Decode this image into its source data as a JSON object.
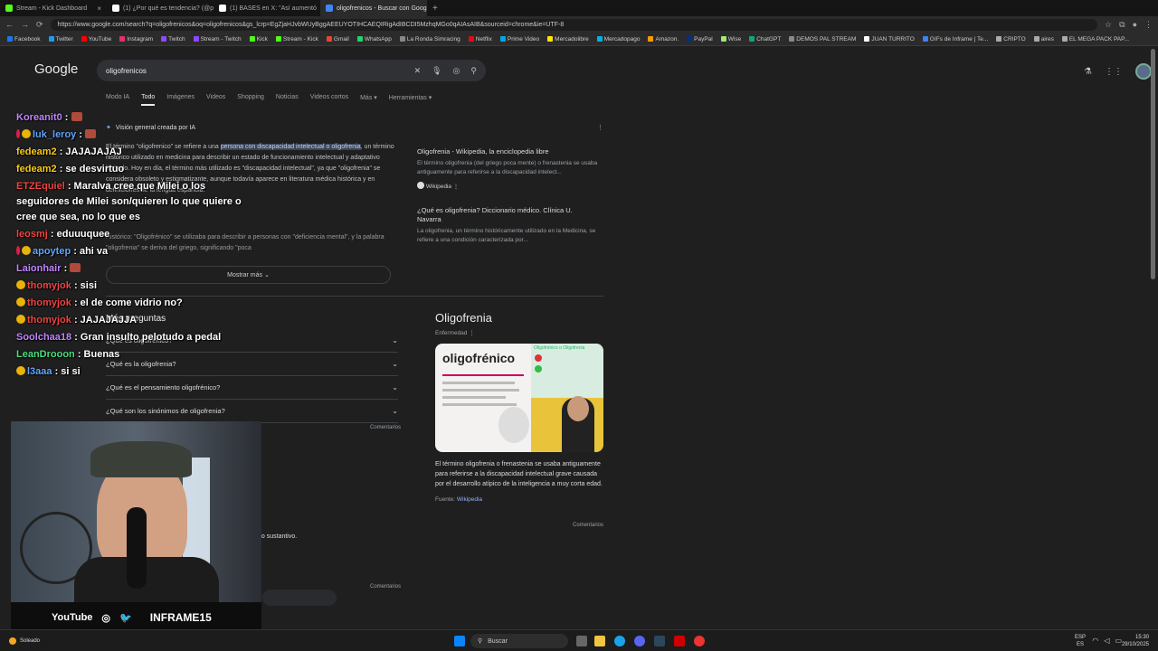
{
  "tabs": [
    {
      "label": "Stream - Kick Dashboard",
      "color": "#53fc18"
    },
    {
      "label": "(1) ¿Por qué es tendencia? (@por",
      "color": "#fff"
    },
    {
      "label": "(1) BASES en X: \"Así aumentó",
      "color": "#fff"
    },
    {
      "label": "oligofrenicos - Buscar con Google",
      "color": "#4285f4",
      "active": true
    }
  ],
  "url": "https://www.google.com/search?q=oligofrenicos&oq=oligofrenicos&gs_lcrp=EgZjaHJvbWUyBggAEEUYOTIHCAEQIRigAdIBCDI5MzhqMGo0qAIAsAIB&sourceid=chrome&ie=UTF-8",
  "bookmarks": [
    {
      "label": "Facebook",
      "color": "#1877f2"
    },
    {
      "label": "Twitter",
      "color": "#1d9bf0"
    },
    {
      "label": "YouTube",
      "color": "#ff0000"
    },
    {
      "label": "Instagram",
      "color": "#e1306c"
    },
    {
      "label": "Twitch",
      "color": "#9146ff"
    },
    {
      "label": "Stream - Twitch",
      "color": "#9146ff"
    },
    {
      "label": "Kick",
      "color": "#53fc18"
    },
    {
      "label": "Stream - Kick",
      "color": "#53fc18"
    },
    {
      "label": "Gmail",
      "color": "#ea4335"
    },
    {
      "label": "WhatsApp",
      "color": "#25d366"
    },
    {
      "label": "La Ronda Simracing",
      "color": "#888"
    },
    {
      "label": "Netflix",
      "color": "#e50914"
    },
    {
      "label": "Prime Video",
      "color": "#00a8e1"
    },
    {
      "label": "Mercadolibre",
      "color": "#ffe600"
    },
    {
      "label": "Mercadopago",
      "color": "#00b1ea"
    },
    {
      "label": "Amazon.",
      "color": "#ff9900"
    },
    {
      "label": "PayPal",
      "color": "#003087"
    },
    {
      "label": "Wise",
      "color": "#9fe870"
    },
    {
      "label": "ChatGPT",
      "color": "#10a37f"
    },
    {
      "label": "DEMOS PAL STREAM",
      "color": "#888"
    },
    {
      "label": "JUAN TURRITO",
      "color": "#fff"
    },
    {
      "label": "GIFs de Inframe | Te...",
      "color": "#3b82f6"
    },
    {
      "label": "CRIPTO",
      "color": "#aaa"
    },
    {
      "label": "aires",
      "color": "#aaa"
    },
    {
      "label": "EL MEGA PACK PAP...",
      "color": "#aaa"
    }
  ],
  "google": {
    "logo": "Google",
    "query": "oligofrenicos"
  },
  "search_tabs": [
    "Modo IA",
    "Todo",
    "Imágenes",
    "Videos",
    "Shopping",
    "Noticias",
    "Videos cortos",
    "Más ▾",
    "Herramientas ▾"
  ],
  "ai": {
    "title": "Visión general creada por IA",
    "p1": "El término \"oligofrenico\" se refiere a una ",
    "p1_hl": "persona con discapacidad intelectual o oligofrenia",
    "p1_rest": ", un término histórico utilizado en medicina para describir un estado de funcionamiento intelectual y adaptativo limitado. Hoy en día, el término más utilizado es \"discapacidad intelectual\", ya que \"oligofrenia\" se considera obsoleto y estigmatizante, aunque todavía aparece en literatura médica histórica y en definiciones de la lengua española.",
    "hist": "Histórico: \"Oligofrénico\" se utilizaba para describir a personas con \"deficiencia mental\", y la palabra \"oligofrenia\" se deriva del griego, significando \"poca",
    "show_more": "Mostrar más ⌄",
    "sources": [
      {
        "title": "Oligofrenia - Wikipedia, la enciclopedia libre",
        "desc": "El término oligofrenia (del griego poca mente) o frenastenia se usaba antiguamente para referirse a la discapacidad intelect...",
        "site": "Wikipedia"
      },
      {
        "title": "¿Qué es oligofrenia? Diccionario médico. Clínica U. Navarra",
        "desc": "La oligofrenia, un término históricamente utilizado en la Medicina, se refiere a una condición caracterizada por..."
      }
    ]
  },
  "more_questions": {
    "title": "Más preguntas",
    "items": [
      "¿Qué es oligofrénico?",
      "¿Qué es la oligofrenia?",
      "¿Qué es el pensamiento oligofrénico?",
      "¿Qué son los sinónimos de oligofrenia?"
    ],
    "comments": "Comentarios"
  },
  "knowledge": {
    "title": "Oligofrenia",
    "subtitle": "Enfermedad",
    "img_word": "oligofrénico",
    "img_head": "Oligofrénico o Oligofrenia",
    "text": "El término oligofrenia o frenastenia se usaba antiguamente para referirse a la discapacidad intelectual grave causada por el desarrollo atípico de la inteligencia a muy corta edad.",
    "source_label": "Fuente:",
    "source": "Wikipedia",
    "comments": "Comentarios"
  },
  "lower": {
    "sust": "no sustantivo.",
    "comments": "Comentarios"
  },
  "chat": [
    {
      "user": "Koreanit0",
      "color": "#c084fc",
      "text": " : ",
      "emote": true
    },
    {
      "user": "luk_leroy",
      "color": "#60a5fa",
      "text": " : ",
      "emote": true,
      "badge": "#eab308",
      "dot": true
    },
    {
      "user": "fedeam2",
      "color": "#facc15",
      "text": " : JAJAJAJAJ"
    },
    {
      "user": "fedeam2",
      "color": "#facc15",
      "text": " : se desvirtuo"
    },
    {
      "user": "ETZEquiel",
      "color": "#ef4444",
      "text": " : Maralva cree que Milei o los seguidores de Milei son/quieren lo que quiere o cree que sea, no lo que es"
    },
    {
      "user": "leosmj",
      "color": "#ef4444",
      "text": " : eduuuquee"
    },
    {
      "user": "apoytep",
      "color": "#60a5fa",
      "text": " : ahi va",
      "badge": "#eab308",
      "dot": true
    },
    {
      "user": "Laionhair",
      "color": "#c084fc",
      "text": " : ",
      "emote": true
    },
    {
      "user": "thomyjok",
      "color": "#ef4444",
      "text": " : sisi",
      "badge": "#eab308"
    },
    {
      "user": "thomyjok",
      "color": "#ef4444",
      "text": " : el de come vidrio no?",
      "badge": "#eab308"
    },
    {
      "user": "thomyjok",
      "color": "#ef4444",
      "text": " : JAJAJAJJA",
      "badge": "#eab308"
    },
    {
      "user": "Soolchaa18",
      "color": "#c084fc",
      "text": " : Gran insulto pelotudo a pedal"
    },
    {
      "user": "LeanDrooon",
      "color": "#4ade80",
      "text": " : Buenas"
    },
    {
      "user": "l3aaa",
      "color": "#60a5fa",
      "text": " : si si",
      "badge": "#eab308"
    }
  ],
  "stream_footer": {
    "youtube": "YouTube",
    "brand": "INFRAME15"
  },
  "taskbar": {
    "search": "Buscar",
    "weather": "Soleado",
    "lang1": "ESP",
    "lang2": "ES",
    "time": "15:30",
    "date": "29/10/2025"
  }
}
